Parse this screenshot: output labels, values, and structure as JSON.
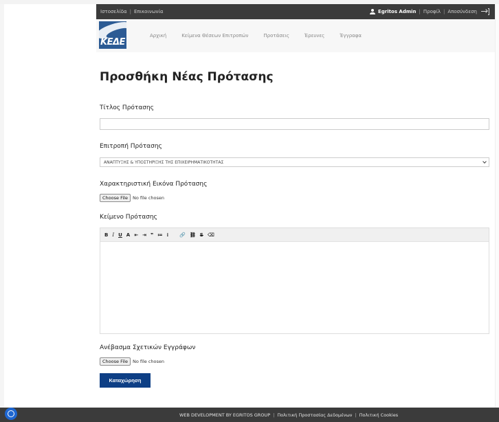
{
  "topbar": {
    "left_links": [
      "Ιστοσελίδα",
      "Επικοινωνία"
    ],
    "separator": "|",
    "user_name": "Egritos Admin",
    "profile_link": "Προφίλ",
    "logout_link": "Αποσύνδεση"
  },
  "brand": {
    "logo_text": "ΚΕΔΕ"
  },
  "nav": {
    "items": [
      "Αρχική",
      "Κείμενα Θέσεων Επιτροπών",
      "Προτάσεις",
      "Έρευνες",
      "Έγγραφα"
    ]
  },
  "page": {
    "title": "Προσθήκη Νέας Πρότασης"
  },
  "form": {
    "title_label": "Τίτλος Πρότασης",
    "title_value": "",
    "committee_label": "Επιτροπή Πρότασης",
    "committee_selected": "ΑΝΑΠΤΥΞΗΣ & ΥΠΟΣΤΗΡΙΞΗΣ ΤΗΣ ΕΠΙΧΕΙΡΗΜΑΤΙΚΟΤΗΤΑΣ",
    "image_label": "Χαρακτηριστική Εικόνα Πρότασης",
    "choose_file_label": "Choose File",
    "no_file_text": "No file chosen",
    "body_label": "Κείμενο Πρότασης",
    "docs_label": "Ανέβασμα Σχετικών Εγγράφων",
    "submit_label": "Καταχώρηση"
  },
  "editor": {
    "toolbar": [
      "B",
      "I",
      "U",
      "A",
      "⇤",
      "⇥",
      "❞",
      "≔",
      "⁝",
      "🔗",
      "⛓",
      "S",
      "⌫"
    ]
  },
  "footer": {
    "credit": "WEB DEVELOPMENT BY EGRITOS GROUP",
    "privacy": "Πολιτική Προστασίας Δεδομένων",
    "cookies": "Πολιτική Cookies",
    "separator": "|"
  },
  "colors": {
    "topbar_bg": "#3b3b3b",
    "primary": "#0e3f85",
    "cookie_badge": "#1e66d0"
  }
}
